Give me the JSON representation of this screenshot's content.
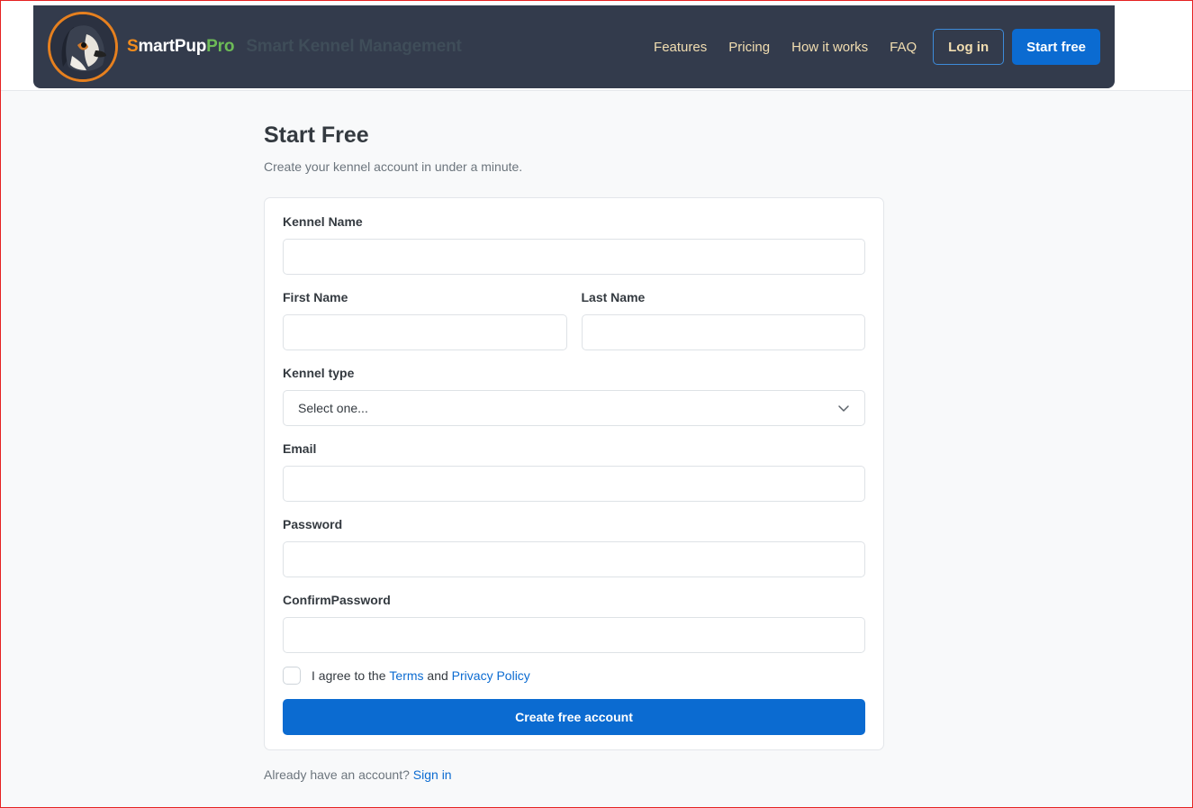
{
  "brand": {
    "name_part1": "S",
    "name_part2": "martPup",
    "name_part3": "Pro",
    "tagline": "Smart Kennel Management"
  },
  "nav": {
    "links": [
      "Features",
      "Pricing",
      "How it works",
      "FAQ"
    ],
    "login_label": "Log in",
    "start_label": "Start free"
  },
  "page": {
    "title": "Start Free",
    "subtitle": "Create your kennel account in under a minute."
  },
  "form": {
    "kennel_name_label": "Kennel Name",
    "kennel_name_value": "",
    "first_name_label": "First Name",
    "first_name_value": "",
    "last_name_label": "Last Name",
    "last_name_value": "",
    "kennel_type_label": "Kennel type",
    "kennel_type_selected": "Select one...",
    "email_label": "Email",
    "email_value": "",
    "password_label": "Password",
    "password_value": "",
    "confirm_password_label": "ConfirmPassword",
    "confirm_password_value": "",
    "agree_prefix": "I agree to the",
    "terms_link": "Terms",
    "agree_and": "and",
    "privacy_link": "Privacy Policy",
    "submit_label": "Create free account"
  },
  "footer": {
    "prompt": "Already have an account?",
    "signin_link": "Sign in"
  },
  "icons": {
    "logo": "dog-logo-icon",
    "select": "chevron-down-icon"
  },
  "colors": {
    "navbar_bg": "#333b4c",
    "primary": "#0b6bd1",
    "brand_orange": "#f28c1c",
    "brand_green": "#6dbb57",
    "nav_text": "#f1ddb0"
  }
}
